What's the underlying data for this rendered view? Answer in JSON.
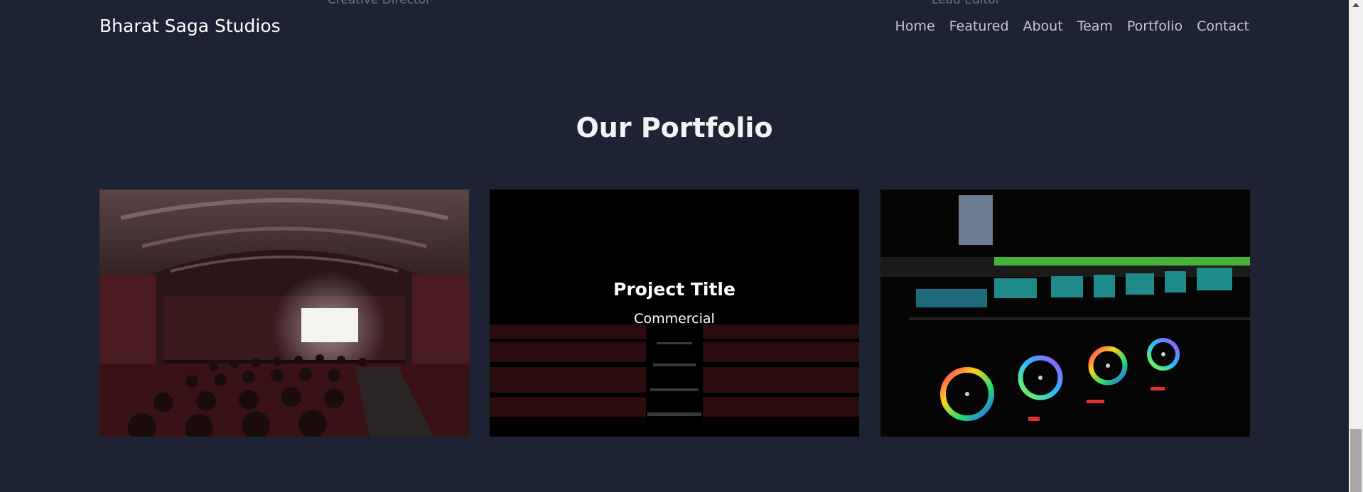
{
  "ghost_captions": [
    "Creative Director",
    "Lead Editor"
  ],
  "navbar": {
    "brand": "Bharat Saga Studios",
    "links": [
      "Home",
      "Featured",
      "About",
      "Team",
      "Portfolio",
      "Contact"
    ]
  },
  "portfolio": {
    "heading": "Our Portfolio",
    "items": [
      {
        "image": "cinema-audience-image"
      },
      {
        "image": "theater-seats-image",
        "title": "Project Title",
        "category": "Commercial"
      },
      {
        "image": "color-grading-software-image"
      }
    ]
  },
  "colors": {
    "background": "#1e2333",
    "text": "#ffffff",
    "nav_text": "#c4c8d0"
  }
}
